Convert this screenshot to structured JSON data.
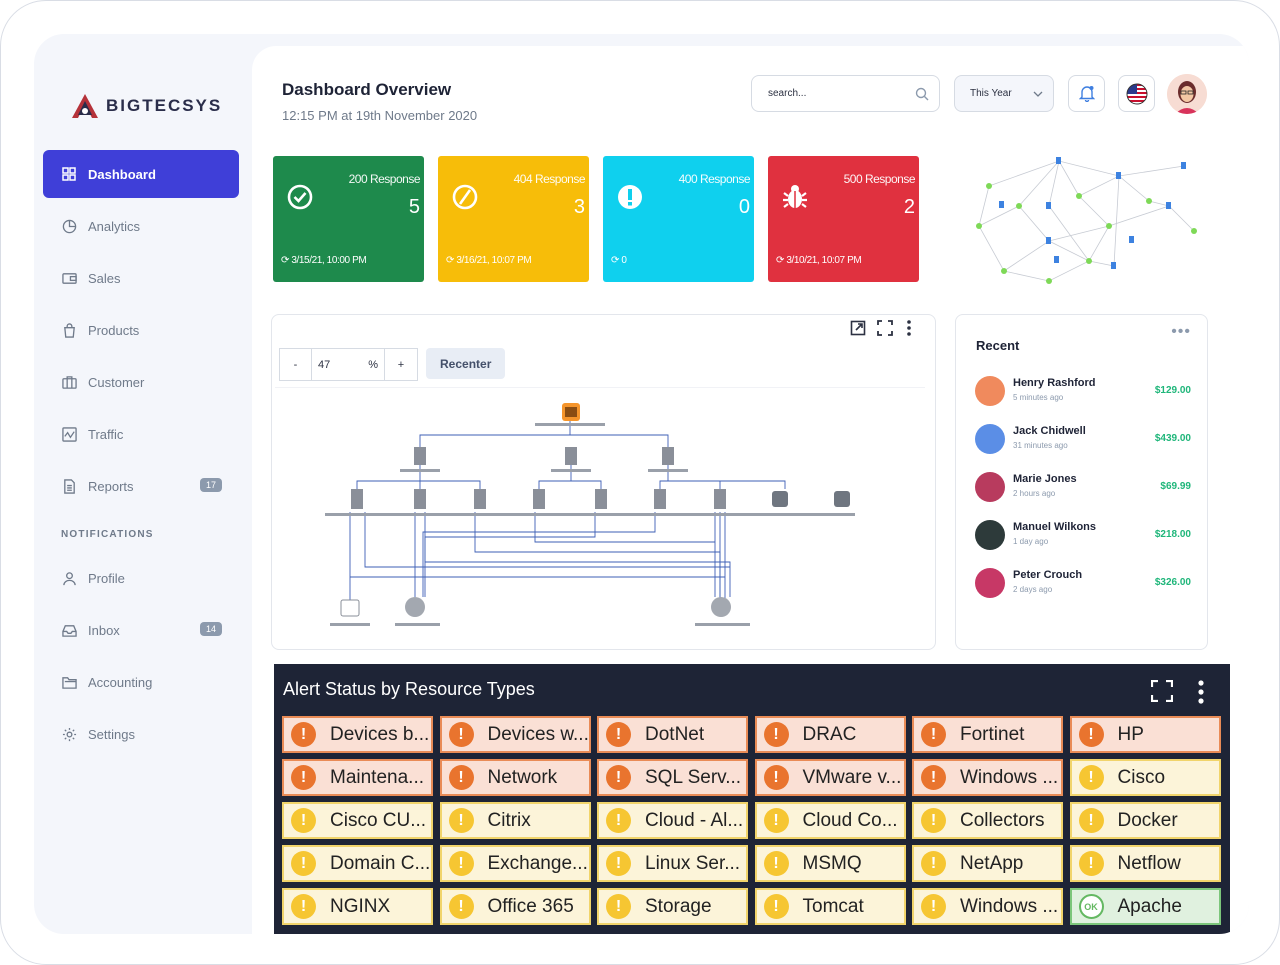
{
  "brand": {
    "name": "BIGTECSYS"
  },
  "sidebar": {
    "items": [
      {
        "label": "Dashboard",
        "icon": "grid-icon",
        "active": true
      },
      {
        "label": "Analytics",
        "icon": "pie-chart-icon"
      },
      {
        "label": "Sales",
        "icon": "wallet-icon"
      },
      {
        "label": "Products",
        "icon": "shopping-bag-icon"
      },
      {
        "label": "Customer",
        "icon": "briefcase-icon"
      },
      {
        "label": "Traffic",
        "icon": "activity-icon"
      },
      {
        "label": "Reports",
        "icon": "document-icon",
        "badge": "17"
      }
    ],
    "section_label": "NOTIFICATIONS",
    "items2": [
      {
        "label": "Profile",
        "icon": "user-icon"
      },
      {
        "label": "Inbox",
        "icon": "inbox-icon",
        "badge": "14"
      },
      {
        "label": "Accounting",
        "icon": "folder-icon"
      },
      {
        "label": "Settings",
        "icon": "gear-icon"
      }
    ]
  },
  "header": {
    "title": "Dashboard Overview",
    "subtitle": "12:15 PM at 19th November 2020",
    "search_placeholder": "search...",
    "period": "This Year"
  },
  "cards": [
    {
      "label": "200 Response",
      "value": "5",
      "foot": "3/15/21, 10:00 PM",
      "color": "#1e8a4c",
      "icon": "check-circle-icon"
    },
    {
      "label": "404 Response",
      "value": "3",
      "foot": "3/16/21, 10:07 PM",
      "color": "#f7bd09",
      "icon": "ban-icon"
    },
    {
      "label": "400 Response",
      "value": "0",
      "foot": "0",
      "color": "#0fd0ee",
      "icon": "exclamation-icon"
    },
    {
      "label": "500 Response",
      "value": "2",
      "foot": "3/10/21, 10:07 PM",
      "color": "#e0313f",
      "icon": "bug-icon"
    }
  ],
  "topology": {
    "zoom_minus": "-",
    "zoom_value": "47",
    "zoom_unit": "%",
    "zoom_plus": "+",
    "recenter": "Recenter"
  },
  "recent": {
    "title": "Recent",
    "items": [
      {
        "name": "Henry Rashford",
        "time": "5 minutes ago",
        "amount": "$129.00",
        "color": "#f08a5d"
      },
      {
        "name": "Jack Chidwell",
        "time": "31 minutes ago",
        "amount": "$439.00",
        "color": "#5b8ee6"
      },
      {
        "name": "Marie Jones",
        "time": "2 hours ago",
        "amount": "$69.99",
        "color": "#b83b5e"
      },
      {
        "name": "Manuel Wilkons",
        "time": "1 day ago",
        "amount": "$218.00",
        "color": "#2d3a3a"
      },
      {
        "name": "Peter Crouch",
        "time": "2 days ago",
        "amount": "$326.00",
        "color": "#c73866"
      }
    ]
  },
  "alerts": {
    "title": "Alert Status by Resource Types",
    "cells": [
      {
        "label": "Devices b...",
        "status": "crit"
      },
      {
        "label": "Devices w...",
        "status": "crit"
      },
      {
        "label": "DotNet",
        "status": "crit"
      },
      {
        "label": "DRAC",
        "status": "crit"
      },
      {
        "label": "Fortinet",
        "status": "crit"
      },
      {
        "label": "HP",
        "status": "crit"
      },
      {
        "label": "Maintena...",
        "status": "crit"
      },
      {
        "label": "Network",
        "status": "crit"
      },
      {
        "label": "SQL Serv...",
        "status": "crit"
      },
      {
        "label": "VMware v...",
        "status": "crit"
      },
      {
        "label": "Windows ...",
        "status": "crit"
      },
      {
        "label": "Cisco",
        "status": "warn"
      },
      {
        "label": "Cisco CU...",
        "status": "warn"
      },
      {
        "label": "Citrix",
        "status": "warn"
      },
      {
        "label": "Cloud - Al...",
        "status": "warn"
      },
      {
        "label": "Cloud Co...",
        "status": "warn"
      },
      {
        "label": "Collectors",
        "status": "warn"
      },
      {
        "label": "Docker",
        "status": "warn"
      },
      {
        "label": "Domain C...",
        "status": "warn"
      },
      {
        "label": "Exchange...",
        "status": "warn"
      },
      {
        "label": "Linux Ser...",
        "status": "warn"
      },
      {
        "label": "MSMQ",
        "status": "warn"
      },
      {
        "label": "NetApp",
        "status": "warn"
      },
      {
        "label": "Netflow",
        "status": "warn"
      },
      {
        "label": "NGINX",
        "status": "warn"
      },
      {
        "label": "Office 365",
        "status": "warn"
      },
      {
        "label": "Storage",
        "status": "warn"
      },
      {
        "label": "Tomcat",
        "status": "warn"
      },
      {
        "label": "Windows ...",
        "status": "warn"
      },
      {
        "label": "Apache",
        "status": "ok",
        "icon_text": "OK"
      }
    ]
  }
}
